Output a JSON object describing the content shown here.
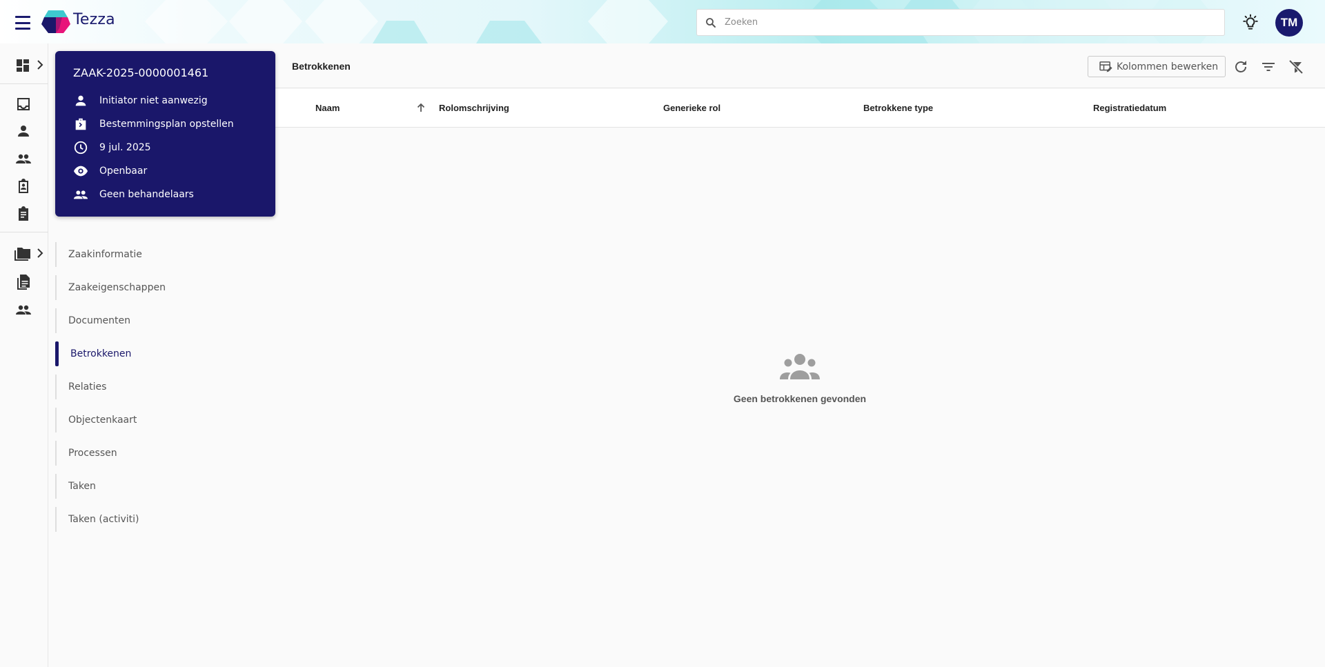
{
  "app": {
    "brand": "Tezza",
    "user_initials": "TM"
  },
  "search": {
    "placeholder": "Zoeken"
  },
  "case": {
    "id": "ZAAK-2025-0000001461",
    "details": [
      {
        "icon": "person-icon",
        "text": "Initiator niet aanwezig"
      },
      {
        "icon": "briefcase-icon",
        "text": "Bestemmingsplan opstellen"
      },
      {
        "icon": "clock-icon",
        "text": "9 jul. 2025"
      },
      {
        "icon": "eye-icon",
        "text": "Openbaar"
      },
      {
        "icon": "people-icon",
        "text": "Geen behandelaars"
      }
    ]
  },
  "subnav": {
    "items": [
      {
        "label": "Zaakinformatie",
        "active": false
      },
      {
        "label": "Zaakeigenschappen",
        "active": false
      },
      {
        "label": "Documenten",
        "active": false
      },
      {
        "label": "Betrokkenen",
        "active": true
      },
      {
        "label": "Relaties",
        "active": false
      },
      {
        "label": "Objectenkaart",
        "active": false
      },
      {
        "label": "Processen",
        "active": false
      },
      {
        "label": "Taken",
        "active": false
      },
      {
        "label": "Taken (activiti)",
        "active": false
      }
    ]
  },
  "panel": {
    "title": "Betrokkenen",
    "edit_columns_label": "Kolommen bewerken",
    "columns": [
      "Naam",
      "Rolomschrijving",
      "Generieke rol",
      "Betrokkene type",
      "Registratiedatum"
    ],
    "sort_column": "Naam",
    "empty_message": "Geen betrokkenen gevonden"
  },
  "colors": {
    "primary": "#1a176a",
    "accent_pink": "#e8157a",
    "accent_teal": "#3ec9cf"
  }
}
